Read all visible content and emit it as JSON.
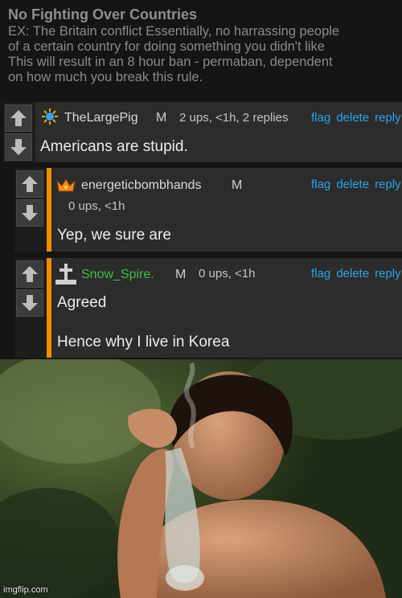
{
  "rules": {
    "title": "No Fighting Over Countries",
    "lines": [
      "EX: The Britain conflict Essentially, no harrassing people",
      "of a certain country for doing something you didn't like",
      "This will result in an 8 hour ban - permaban, dependent",
      "on how much you break this rule."
    ]
  },
  "actions": {
    "flag": "flag",
    "delete": "delete",
    "reply": "reply"
  },
  "comments": [
    {
      "username": "TheLargePig",
      "mark": "M",
      "meta": "2 ups, <1h, 2 replies",
      "icon": "sun-icon",
      "lines": [
        "Americans are stupid."
      ]
    },
    {
      "username": "energeticbombhands",
      "mark": "M",
      "meta": "0 ups, <1h",
      "icon": "crown-icon",
      "lines": [
        "Yep, we sure are"
      ]
    },
    {
      "username": "Snow_Spire.",
      "mark": "M",
      "meta": "0 ups, <1h",
      "icon": "grave-cross-icon",
      "lines": [
        "Agreed",
        "Hence why I live in Korea"
      ]
    }
  ],
  "colors": {
    "accent": "#f28c00",
    "link": "#2aa3e8",
    "username_green": "#3fbf3f",
    "background": "#151515"
  },
  "image": {
    "watermark": "imgflip.com"
  }
}
